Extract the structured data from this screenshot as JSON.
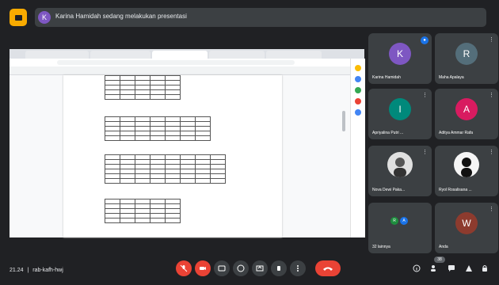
{
  "top_bar": {
    "presenter_initial": "K",
    "presenter_text": "Karina Hamidah sedang melakukan presentasi"
  },
  "participants": [
    {
      "name": "Karina Hamidah",
      "initial": "K",
      "color": "#7e57c2",
      "speaking": true
    },
    {
      "name": "Maha Apalaya",
      "initial": "R",
      "color": "#546e7a"
    },
    {
      "name": "Apriyalina Putri ...",
      "initial": "I",
      "color": "#00897b"
    },
    {
      "name": "Aditya Ammar Rafa",
      "initial": "A",
      "color": "#d81b60"
    },
    {
      "name": "Nova Dewi Paka...",
      "initial": "",
      "color": "#e0e0e0"
    },
    {
      "name": "Ryol Rosalisana ...",
      "initial": "",
      "color": "#111111"
    },
    {
      "name": "32 lainnya",
      "initial": "",
      "color": "#1e8e3e"
    },
    {
      "name": "Anda",
      "initial": "W",
      "color": "#8d3b2e"
    }
  ],
  "group_tile_initials": [
    "R",
    "A"
  ],
  "bottom_bar": {
    "time": "21.24",
    "separator": "|",
    "meeting_code": "rab-kafh-hwj",
    "participants_count": "38"
  },
  "colors": {
    "background": "#202124",
    "tile": "#3c4043",
    "danger": "#ea4335",
    "accent": "#1a73e8"
  }
}
